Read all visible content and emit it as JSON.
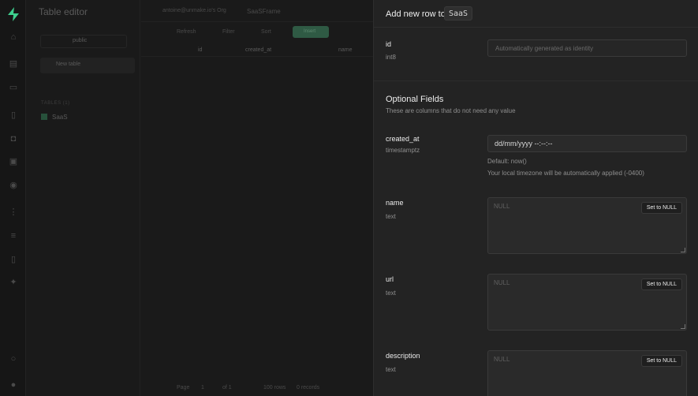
{
  "rail": {
    "icons": [
      "home-icon",
      "table-icon",
      "terminal-icon",
      "database-icon",
      "lock-icon",
      "storage-icon",
      "functions-icon",
      "reports-icon",
      "list-icon",
      "docs-icon",
      "settings-icon",
      "search-icon",
      "user-icon"
    ]
  },
  "editor": {
    "title": "Table editor",
    "schema_label": "public",
    "new_table": "New table",
    "tables_heading": "TABLES (1)",
    "table_name": "SaaS",
    "org": "antoine@unmake.io's Org",
    "project": "SaaSFrame",
    "toolbar": {
      "refresh": "Refresh",
      "filter": "Filter",
      "sort": "Sort",
      "insert": "Insert"
    },
    "columns": [
      "id",
      "created_at",
      "name"
    ],
    "footer": {
      "page": "Page",
      "page_num": "1",
      "of": "of 1",
      "rows": "100 rows",
      "records": "0 records"
    }
  },
  "panel": {
    "title": "Add new row to",
    "table": "SaaS",
    "id_field": {
      "label": "id",
      "type": "int8",
      "placeholder": "Automatically generated as identity"
    },
    "optional_heading": "Optional Fields",
    "optional_sub": "These are columns that do not need any value",
    "created_at": {
      "label": "created_at",
      "type": "timestamptz",
      "value": "dd/mm/yyyy --:--:--",
      "default": "Default: now()",
      "timezone_note": "Your local timezone will be automatically applied (-0400)"
    },
    "fields": [
      {
        "label": "name",
        "type": "text",
        "placeholder": "NULL",
        "null_button": "Set to NULL"
      },
      {
        "label": "url",
        "type": "text",
        "placeholder": "NULL",
        "null_button": "Set to NULL"
      },
      {
        "label": "description",
        "type": "text",
        "placeholder": "NULL",
        "null_button": "Set to NULL"
      }
    ]
  }
}
